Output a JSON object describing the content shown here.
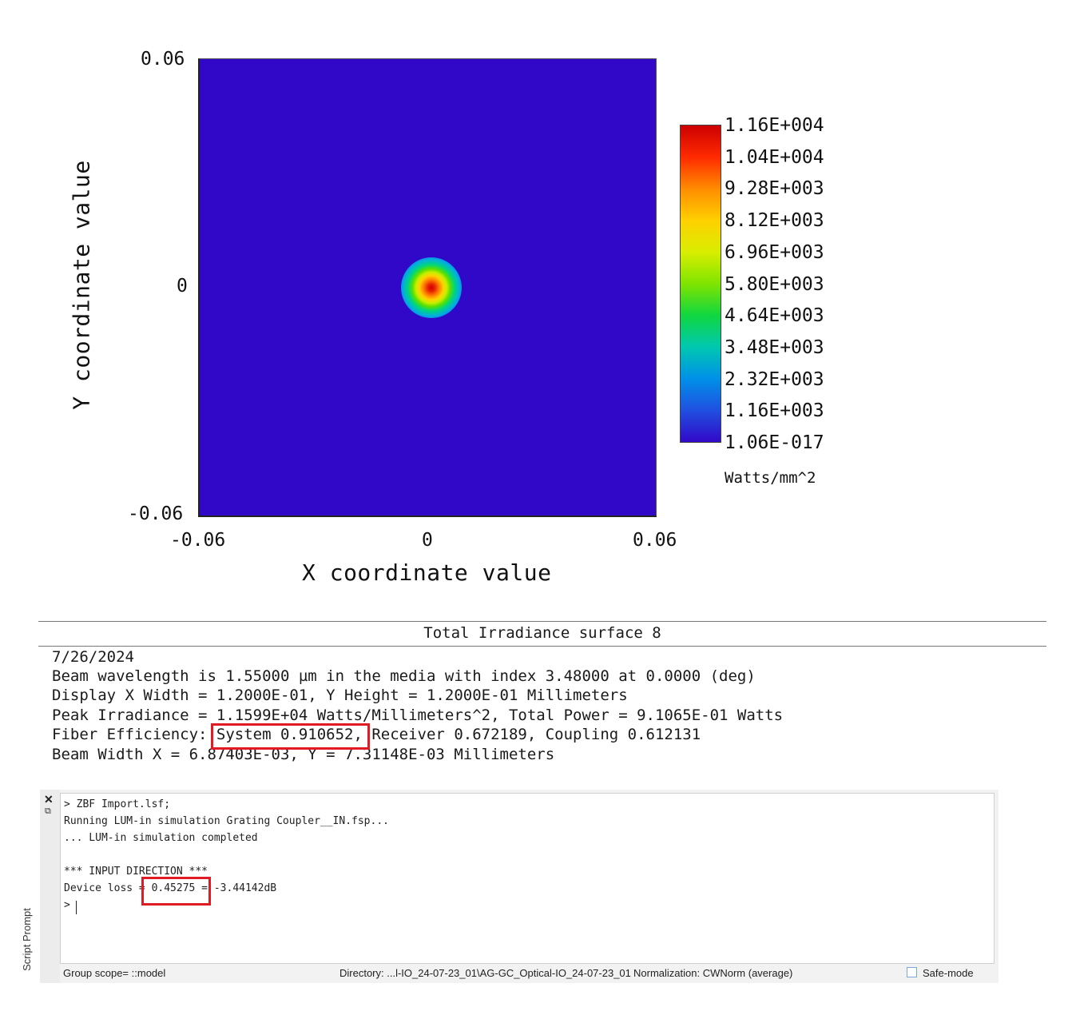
{
  "plot": {
    "y_max_label": "0.06",
    "y_mid_label": "0",
    "y_min_label": "-0.06",
    "x_min_label": "-0.06",
    "x_mid_label": "0",
    "x_max_label": "0.06",
    "x_axis_title": "X coordinate value",
    "y_axis_title": "Y coordinate value",
    "background_color": "#3208c8",
    "peak_color": "#d00000"
  },
  "colorbar": {
    "labels": [
      "1.16E+004",
      "1.04E+004",
      "9.28E+003",
      "8.12E+003",
      "6.96E+003",
      "5.80E+003",
      "4.64E+003",
      "3.48E+003",
      "2.32E+003",
      "1.16E+003",
      "1.06E-017"
    ],
    "unit": "Watts/mm^2"
  },
  "info": {
    "title": "Total Irradiance surface 8",
    "date": "7/26/2024",
    "line1": "Beam wavelength is 1.55000 µm in the media with index 3.48000 at 0.0000 (deg)",
    "line2": "Display X Width = 1.2000E-01, Y Height = 1.2000E-01 Millimeters",
    "line3": "Peak Irradiance = 1.1599E+04 Watts/Millimeters^2, Total Power = 9.1065E-01 Watts",
    "line4": "Fiber Efficiency: System 0.910652, Receiver 0.672189, Coupling 0.612131",
    "line5": "Beam Width X = 6.87403E-03, Y = 7.31148E-03 Millimeters",
    "highlight_color": "#e01b24"
  },
  "script_prompt": {
    "panel_label": "Script Prompt",
    "close_icon": "close-icon",
    "float_icon": "float-window-icon",
    "lines": [
      "> ZBF Import.lsf;",
      "Running LUM-in simulation Grating Coupler__IN.fsp...",
      "... LUM-in simulation completed",
      "",
      "*** INPUT DIRECTION ***",
      "Device loss = 0.45275 = -3.44142dB",
      ">"
    ],
    "status_group_scope": "Group scope= ::model",
    "status_directory": "Directory: ...l-IO_24-07-23_01\\AG-GC_Optical-IO_24-07-23_01",
    "status_normalization": "Normalization: CWNorm (average)",
    "safe_mode_label": "Safe-mode",
    "safe_mode_checked": false
  }
}
